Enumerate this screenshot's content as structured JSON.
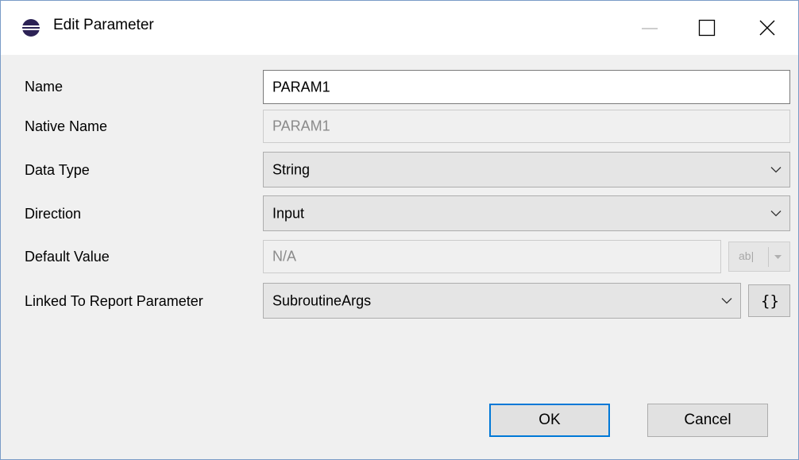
{
  "window": {
    "title": "Edit Parameter",
    "icons": {
      "app": "eclipse-icon",
      "minimize": "minimize-icon",
      "maximize": "maximize-icon",
      "close": "close-icon"
    }
  },
  "form": {
    "name": {
      "label": "Name",
      "value": "PARAM1"
    },
    "native_name": {
      "label": "Native Name",
      "value": "PARAM1"
    },
    "data_type": {
      "label": "Data Type",
      "value": "String"
    },
    "direction": {
      "label": "Direction",
      "value": "Input"
    },
    "default_value": {
      "label": "Default Value",
      "value": "N/A",
      "type_button_label": "ab|"
    },
    "linked_report_parameter": {
      "label": "Linked To Report Parameter",
      "value": "SubroutineArgs",
      "expression_button_label": "{}"
    }
  },
  "buttons": {
    "ok": "OK",
    "cancel": "Cancel"
  },
  "colors": {
    "accent": "#0078d7",
    "window_border": "#7a9cc7",
    "dialog_bg": "#f0f0f0"
  }
}
